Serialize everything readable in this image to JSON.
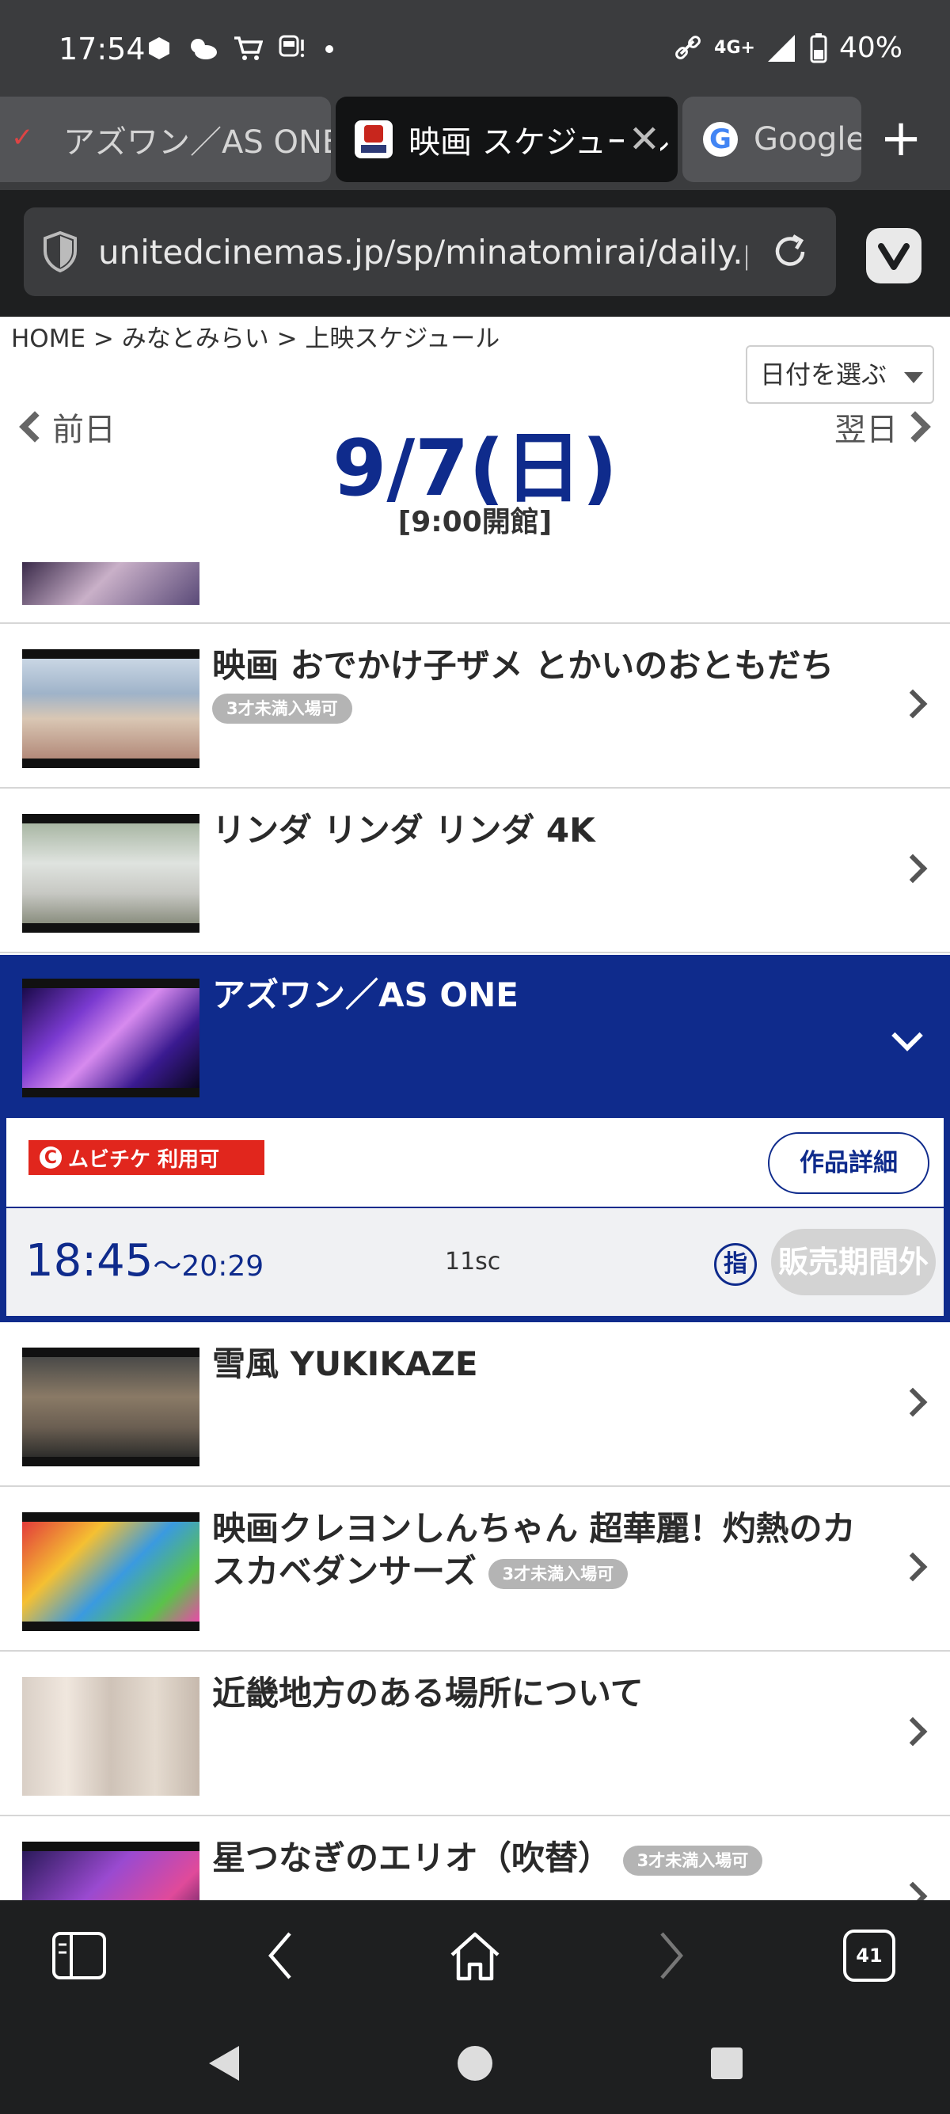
{
  "status_bar": {
    "time": "17:54",
    "network": "4G+",
    "battery": "40%"
  },
  "tabs": [
    {
      "label": "アズワン／AS ONE",
      "active": false
    },
    {
      "label": "映画 スケジュール",
      "active": true
    },
    {
      "label": "Google",
      "active": false
    }
  ],
  "address_bar": {
    "url": "unitedcinemas.jp/sp/minatomirai/daily.php"
  },
  "page": {
    "breadcrumb": "HOME > みなとみらい > 上映スケジュール",
    "date_select": "日付を選ぶ",
    "prev_day": "前日",
    "next_day": "翌日",
    "date": "9/7(日)",
    "open_time": "[9:00開館]"
  },
  "movies": [
    {
      "title": "映画 おでかけ子ザメ とかいのおともだち",
      "badge": "3才未満入場可"
    },
    {
      "title": "リンダ リンダ リンダ 4K",
      "badge": ""
    },
    {
      "title": "アズワン／AS ONE",
      "badge": "",
      "expanded": true
    },
    {
      "title": "雪風 YUKIKAZE",
      "badge": ""
    },
    {
      "title": "映画クレヨンしんちゃん 超華麗！灼熱のカスカベダンサーズ",
      "badge": "3才未満入場可"
    },
    {
      "title": "近畿地方のある場所について",
      "badge": ""
    },
    {
      "title": "星つなぎのエリオ（吹替）",
      "badge": "3才未満入場可"
    }
  ],
  "expanded_detail": {
    "mvtk_label": "ムビチケ 利用可",
    "detail_button": "作品詳細",
    "showtime_start": "18:45",
    "showtime_end": "〜20:29",
    "screen": "11sc",
    "reserved_mark": "指",
    "sales_status": "販売期間外"
  },
  "toolbar": {
    "tab_count": "41"
  },
  "colors": {
    "brand_blue": "#0f2b8c",
    "mvtk_red": "#e1261d"
  }
}
